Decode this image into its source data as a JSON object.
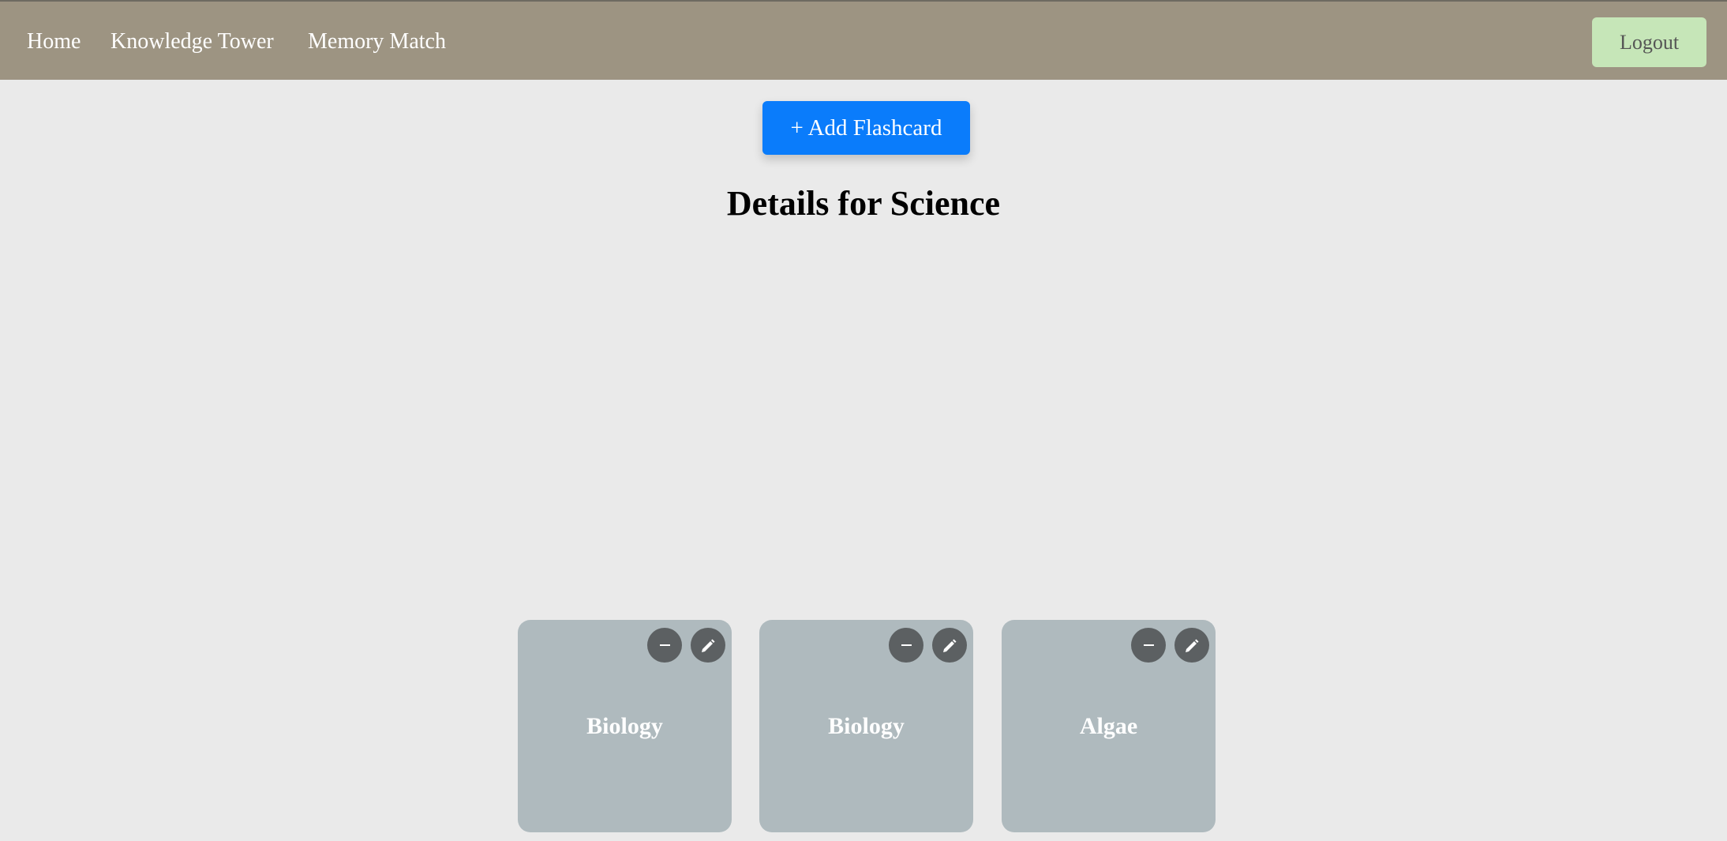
{
  "nav": {
    "links": [
      {
        "label": "Home"
      },
      {
        "label": "Knowledge Tower"
      },
      {
        "label": "Memory Match"
      }
    ],
    "logout_label": "Logout"
  },
  "main": {
    "add_button_label": "+ Add Flashcard",
    "title": "Details for Science"
  },
  "cards": [
    {
      "label": "Biology",
      "remove_icon": "minus-icon",
      "edit_icon": "pencil-icon"
    },
    {
      "label": "Biology",
      "remove_icon": "minus-icon",
      "edit_icon": "pencil-icon"
    },
    {
      "label": "Algae",
      "remove_icon": "minus-icon",
      "edit_icon": "pencil-icon"
    }
  ],
  "colors": {
    "navbar": "#9d9482",
    "logout_bg": "#c6e6b8",
    "add_button_bg": "#0a7cfb",
    "card_bg": "#afbabe",
    "icon_button_bg": "#5c6062",
    "page_bg": "#eaeaea"
  }
}
